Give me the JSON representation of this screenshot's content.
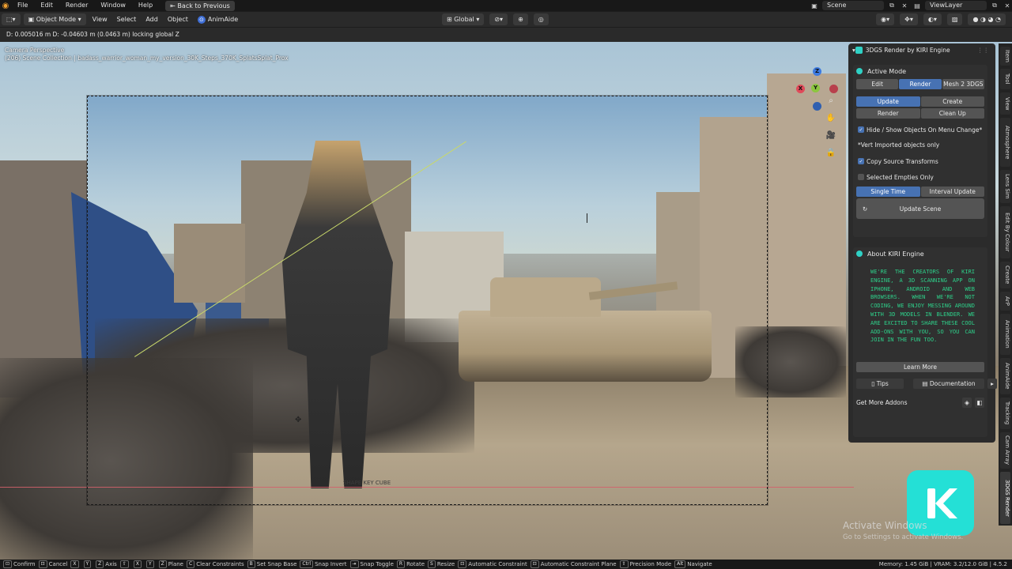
{
  "menu": {
    "items": [
      "File",
      "Edit",
      "Render",
      "Window",
      "Help"
    ],
    "back_button": "Back to Previous",
    "scene": "Scene",
    "view_layer": "ViewLayer"
  },
  "header": {
    "mode": "Object Mode",
    "items": [
      "View",
      "Select",
      "Add",
      "Object"
    ],
    "addon": "AnimAide",
    "transform_orientation": "Global"
  },
  "operator_status": "D: 0.005016 m  D: -0.04603 m (0.0463 m) locking global Z",
  "viewport": {
    "camera": "Camera Perspective",
    "collection": "(206) Scene Collection | badass_warrior_woman_my_version_30K_Steps_370K_SplatsSplat_Prox",
    "object_label": "SHAPE KEY CUBE",
    "gizmo_axes": [
      "Z",
      "Y",
      "X"
    ]
  },
  "panel": {
    "title": "3DGS Render by KIRI Engine",
    "active_mode": {
      "title": "Active Mode",
      "modes": [
        "Edit",
        "Render",
        "Mesh 2 3DGS"
      ],
      "selected_mode": "Render",
      "actions": [
        "Update",
        "Create",
        "Render",
        "Clean Up"
      ],
      "hide_show_label": "Hide / Show Objects On Menu Change*",
      "vert_note": "*Vert Imported objects only",
      "copy_transforms": "Copy Source Transforms",
      "selected_empties": "Selected Empties Only",
      "update_modes": [
        "Single Time",
        "Interval Update"
      ],
      "update_scene": "Update Scene"
    },
    "about": {
      "title": "About KIRI Engine",
      "text": "WE'RE THE CREATORS OF KIRI ENGINE, A 3D SCANNING APP ON IPHONE, ANDROID AND WEB BROWSERS. WHEN WE'RE NOT CODING, WE ENJOY MESSING AROUND WITH 3D MODELS IN BLENDER. WE ARE EXCITED TO SHARE THESE COOL ADD-ONS WITH YOU, SO YOU CAN JOIN IN THE FUN TOO.",
      "learn_more": "Learn More",
      "tips": "Tips",
      "documentation": "Documentation",
      "get_more": "Get More Addons"
    }
  },
  "side_tabs": [
    "Item",
    "Tool",
    "View",
    "Atmosphere",
    "Lens Sim",
    "Edit By Colour",
    "Create",
    "ArP",
    "Animation",
    "AnimAide",
    "Tracking",
    "Cam Array",
    "3DGS Render"
  ],
  "watermark": {
    "title": "Activate Windows",
    "subtitle": "Go to Settings to activate Windows."
  },
  "statusbar": {
    "items": [
      {
        "key": "⊡",
        "label": "Confirm"
      },
      {
        "key": "⊡",
        "label": "Cancel"
      },
      {
        "key": "X",
        "label": ""
      },
      {
        "key": "Y",
        "label": ""
      },
      {
        "key": "Z",
        "label": "Axis"
      },
      {
        "key": "⇧",
        "label": ""
      },
      {
        "key": "X",
        "label": ""
      },
      {
        "key": "Y",
        "label": ""
      },
      {
        "key": "Z",
        "label": "Plane"
      },
      {
        "key": "C",
        "label": "Clear Constraints"
      },
      {
        "key": "B",
        "label": "Set Snap Base"
      },
      {
        "key": "Ctrl",
        "label": "Snap Invert"
      },
      {
        "key": "⇥",
        "label": "Snap Toggle"
      },
      {
        "key": "R",
        "label": "Rotate"
      },
      {
        "key": "S",
        "label": "Resize"
      },
      {
        "key": "⊡",
        "label": "Automatic Constraint"
      },
      {
        "key": "⊡",
        "label": "Automatic Constraint Plane"
      },
      {
        "key": "⇧",
        "label": "Precision Mode"
      },
      {
        "key": "Alt",
        "label": "Navigate"
      }
    ],
    "memory": "Memory: 1.45 GiB | VRAM: 3.2/12.0 GiB | 4.5.2"
  },
  "colors": {
    "accent": "#4772b3",
    "kiri": "#24e0d6",
    "about_text": "#2ed08a"
  }
}
